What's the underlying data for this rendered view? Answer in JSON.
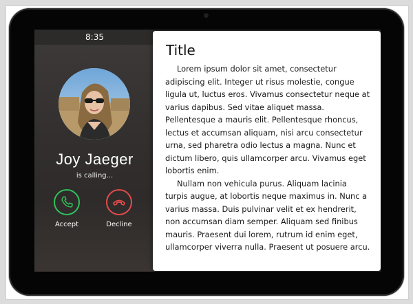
{
  "status_bar": {
    "time": "8:35"
  },
  "call": {
    "caller_name": "Joy Jaeger",
    "status": "is calling...",
    "accept_label": "Accept",
    "decline_label": "Decline",
    "accept_color": "#2fc25a",
    "decline_color": "#e44b4b",
    "accept_icon": "phone-icon",
    "decline_icon": "phone-hangup-icon"
  },
  "card": {
    "title": "Title",
    "paragraphs": [
      "Lorem ipsum dolor sit amet, consectetur adipiscing elit. Integer ut risus molestie, congue ligula ut, luctus eros. Vivamus consectetur neque at varius dapibus. Sed vitae aliquet massa. Pellentesque a mauris elit. Pellentesque rhoncus, lectus et accumsan aliquam, nisi arcu consectetur urna, sed pharetra odio lectus a magna. Nunc et dictum libero, quis ullamcorper arcu. Vivamus eget lobortis enim.",
      "Nullam non vehicula purus. Aliquam lacinia turpis augue, at lobortis neque maximus in. Nunc a varius massa. Duis pulvinar velit et ex hendrerit, non accumsan diam semper. Aliquam sed finibus mauris. Praesent dui lorem, rutrum id enim eget, ullamcorper viverra nulla. Praesent ut posuere arcu."
    ]
  }
}
